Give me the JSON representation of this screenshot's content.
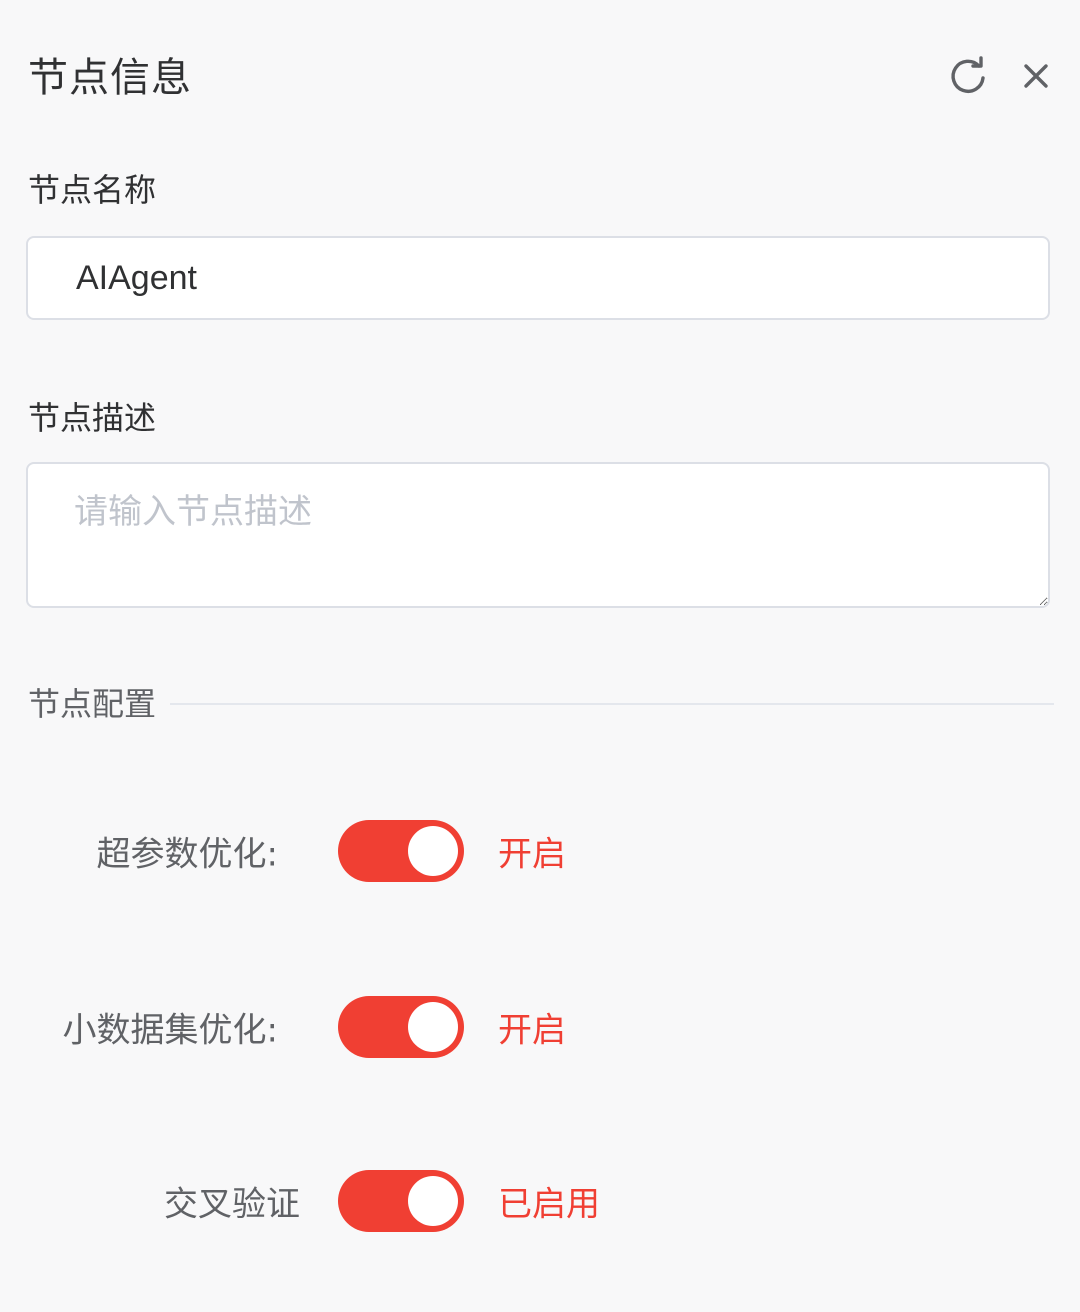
{
  "panel": {
    "title": "节点信息"
  },
  "icons": {
    "refresh": "refresh-icon",
    "close": "close-icon"
  },
  "form": {
    "name_label": "节点名称",
    "name_value": "AIAgent",
    "desc_label": "节点描述",
    "desc_placeholder": "请输入节点描述",
    "desc_value": ""
  },
  "config": {
    "section_title": "节点配置",
    "switches": [
      {
        "label": "超参数优化:",
        "enabled": true,
        "status": "开启"
      },
      {
        "label": "小数据集优化:",
        "enabled": true,
        "status": "开启"
      },
      {
        "label": "交叉验证",
        "enabled": true,
        "status": "已启用"
      }
    ]
  },
  "colors": {
    "accent": "#f03f33",
    "border": "#dcdfe6",
    "background": "#f8f8f9"
  }
}
